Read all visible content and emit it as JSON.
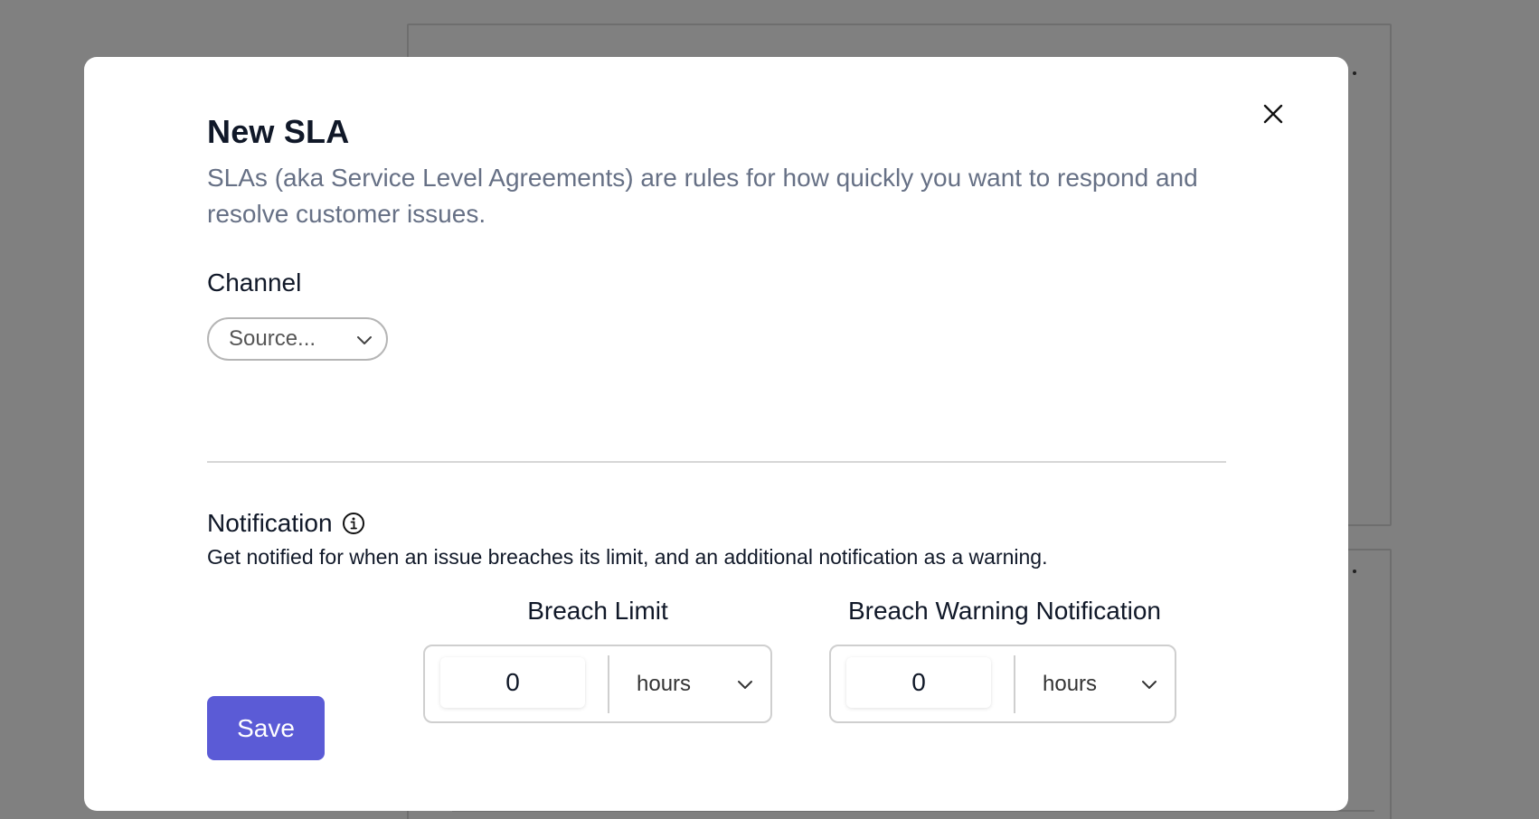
{
  "modal": {
    "title": "New SLA",
    "subtitle": "SLAs (aka Service Level Agreements) are rules for how quickly you want to respond and resolve customer issues.",
    "close_icon": "close-icon"
  },
  "channel": {
    "label": "Channel",
    "select_value": "Source..."
  },
  "notification": {
    "label": "Notification",
    "info_icon": "info-icon",
    "description": "Get notified for when an issue breaches its limit, and an additional notification as a warning."
  },
  "breach_limit": {
    "title": "Breach Limit",
    "value": "0",
    "unit": "hours"
  },
  "breach_warning": {
    "title": "Breach Warning Notification",
    "value": "0",
    "unit": "hours"
  },
  "actions": {
    "save_label": "Save"
  },
  "colors": {
    "overlay": "#808080",
    "accent": "#5b5bd6",
    "subtitle_text": "#667085"
  }
}
